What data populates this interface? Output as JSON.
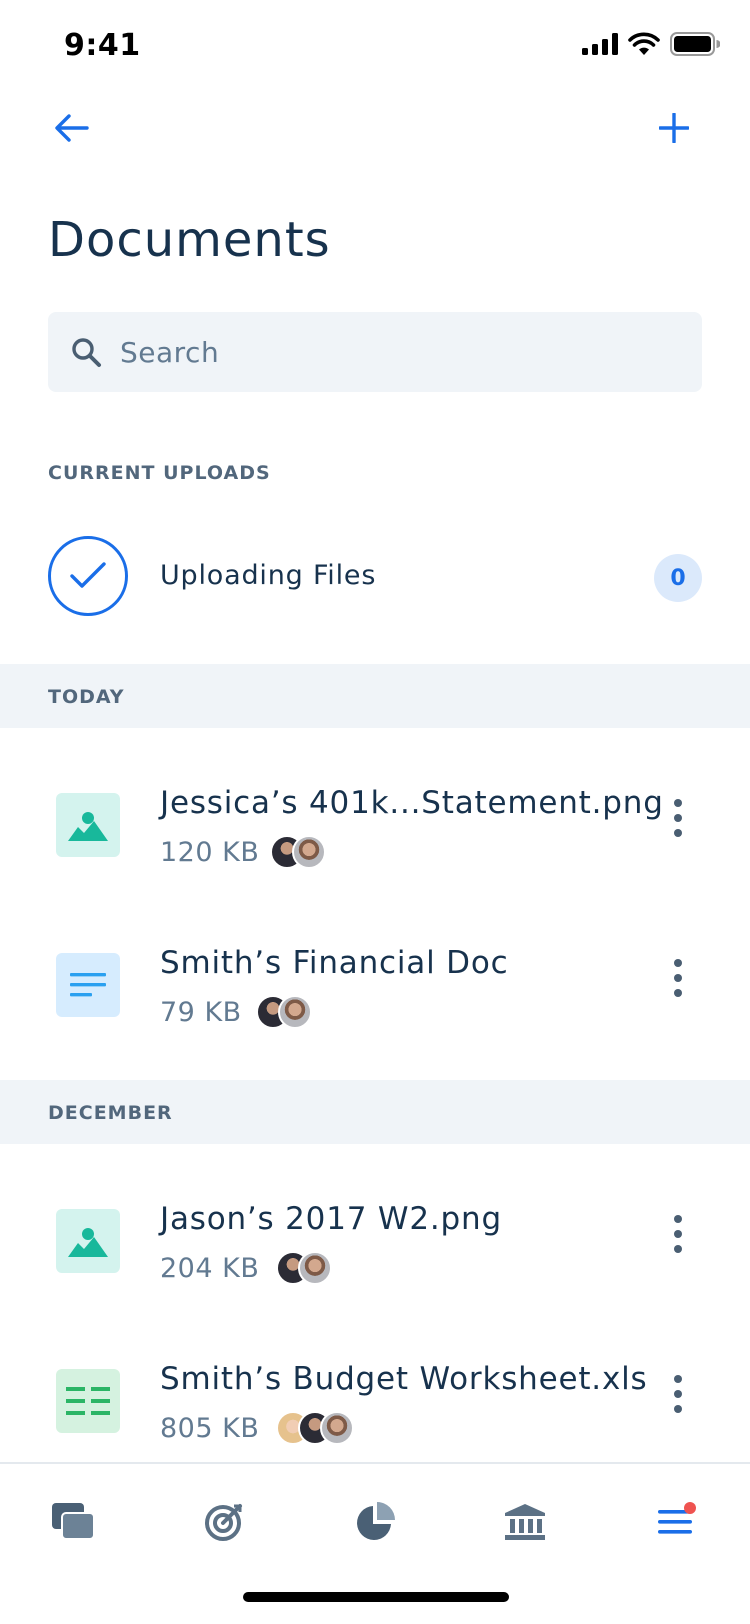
{
  "status_bar": {
    "time": "9:41"
  },
  "header": {
    "title": "Documents"
  },
  "search": {
    "placeholder": "Search"
  },
  "uploads": {
    "section_label": "CURRENT UPLOADS",
    "label": "Uploading Files",
    "count": "0"
  },
  "sections": [
    {
      "label": "TODAY",
      "files": [
        {
          "name": "Jessica’s 401k...Statement.png",
          "size": "120 KB",
          "type": "image"
        },
        {
          "name": "Smith’s Financial Doc",
          "size": "79 KB",
          "type": "doc"
        }
      ]
    },
    {
      "label": "DECEMBER",
      "files": [
        {
          "name": "Jason’s 2017 W2.png",
          "size": "204 KB",
          "type": "image"
        },
        {
          "name": "Smith’s Budget Worksheet.xls",
          "size": "805 KB",
          "type": "sheet"
        }
      ]
    }
  ],
  "tab_bar": {
    "items": [
      {
        "icon": "chat-icon"
      },
      {
        "icon": "target-icon"
      },
      {
        "icon": "pie-chart-icon"
      },
      {
        "icon": "bank-icon"
      },
      {
        "icon": "menu-icon",
        "active": true
      }
    ]
  },
  "colors": {
    "accent": "#1a6ee8",
    "text_primary": "#17324d",
    "text_secondary": "#627a91",
    "band": "#f0f4f8",
    "notification": "#ef5350"
  }
}
